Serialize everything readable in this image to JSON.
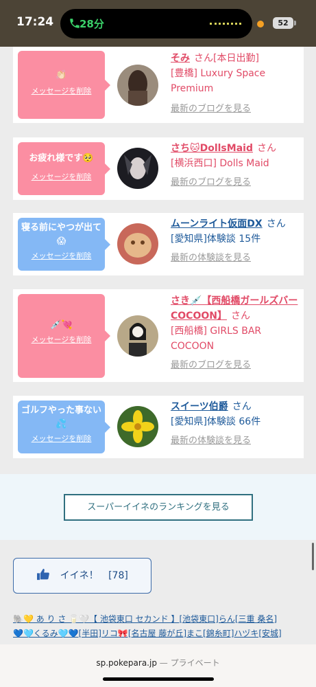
{
  "status": {
    "time": "17:24",
    "call": "28分",
    "battery": "52"
  },
  "colors": {
    "pink": "#fb8ea2",
    "blue": "#84b8f5",
    "name_pink": "#e14a66",
    "name_blue": "#1e5a9a"
  },
  "cards": [
    {
      "message": "👏🏻",
      "delete_label": "メッセージを削除",
      "name": "そみ",
      "san": "さん",
      "detail_1": "[本日出勤]",
      "detail_2": "[豊橋] Luxury Space Premium",
      "latest": "最新のブログを見る"
    },
    {
      "message": "お疲れ様です🥺",
      "delete_label": "メッセージを削除",
      "name": "さち🐱DollsMaid",
      "san": "さん",
      "detail_1": "",
      "detail_2": "[横浜西口] Dolls Maid",
      "latest": "最新のブログを見る"
    },
    {
      "message": "寝る前にやつが出て😱",
      "delete_label": "メッセージを削除",
      "name": "ムーンライト仮面DX",
      "san": "さん",
      "detail_1": "",
      "detail_2": "[愛知県]体験談 15件",
      "latest": "最新の体験談を見る"
    },
    {
      "message": "💉💘",
      "delete_label": "メッセージを削除",
      "name": "さき💉【西船橋ガールズバーCOCOON】",
      "san": "さん",
      "detail_1": "",
      "detail_2": "[西船橋] GIRLS BAR COCOON",
      "latest": "最新のブログを見る"
    },
    {
      "message": "ゴルフやった事ない💦",
      "delete_label": "メッセージを削除",
      "name": "スイーツ伯爵",
      "san": "さん",
      "detail_1": "",
      "detail_2": "[愛知県]体験談 66件",
      "latest": "最新の体験談を見る"
    }
  ],
  "ranking_button": "スーパーイイネのランキングを見る",
  "like_button": {
    "label": "イイネ！",
    "count": "[78]"
  },
  "links": [
    "🐘💛 あ り さ 🥛🤍【 池袋東口 セカンド 】[池袋東口]らん[三重 桑名]",
    "💙🩵くるみ🩵💙[半田]リコ🎀[名古屋 藤が丘]まこ[錦糸町]ハヅキ[安城]"
  ],
  "url": {
    "domain": "sp.pokepara.jp",
    "suffix": "— プライベート"
  }
}
